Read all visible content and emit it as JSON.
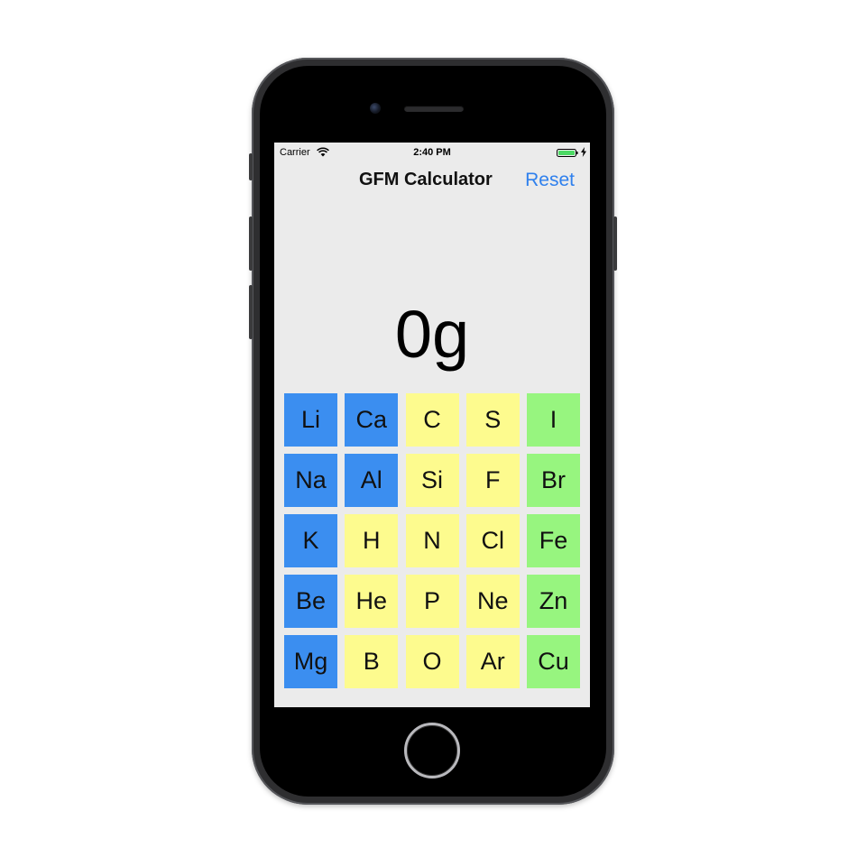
{
  "status_bar": {
    "carrier": "Carrier",
    "time": "2:40 PM"
  },
  "nav": {
    "title": "GFM Calculator",
    "reset_label": "Reset",
    "accent_color": "#2f80ed"
  },
  "display": {
    "value": "0g"
  },
  "colors": {
    "blue": "#3b8ef0",
    "yellow": "#fdfb8e",
    "green": "#97f57f",
    "screen_bg": "#ebebeb"
  },
  "elements": [
    {
      "symbol": "Li",
      "color": "blue"
    },
    {
      "symbol": "Ca",
      "color": "blue"
    },
    {
      "symbol": "C",
      "color": "yellow"
    },
    {
      "symbol": "S",
      "color": "yellow"
    },
    {
      "symbol": "I",
      "color": "green"
    },
    {
      "symbol": "Na",
      "color": "blue"
    },
    {
      "symbol": "Al",
      "color": "blue"
    },
    {
      "symbol": "Si",
      "color": "yellow"
    },
    {
      "symbol": "F",
      "color": "yellow"
    },
    {
      "symbol": "Br",
      "color": "green"
    },
    {
      "symbol": "K",
      "color": "blue"
    },
    {
      "symbol": "H",
      "color": "yellow"
    },
    {
      "symbol": "N",
      "color": "yellow"
    },
    {
      "symbol": "Cl",
      "color": "yellow"
    },
    {
      "symbol": "Fe",
      "color": "green"
    },
    {
      "symbol": "Be",
      "color": "blue"
    },
    {
      "symbol": "He",
      "color": "yellow"
    },
    {
      "symbol": "P",
      "color": "yellow"
    },
    {
      "symbol": "Ne",
      "color": "yellow"
    },
    {
      "symbol": "Zn",
      "color": "green"
    },
    {
      "symbol": "Mg",
      "color": "blue"
    },
    {
      "symbol": "B",
      "color": "yellow"
    },
    {
      "symbol": "O",
      "color": "yellow"
    },
    {
      "symbol": "Ar",
      "color": "yellow"
    },
    {
      "symbol": "Cu",
      "color": "green"
    }
  ]
}
